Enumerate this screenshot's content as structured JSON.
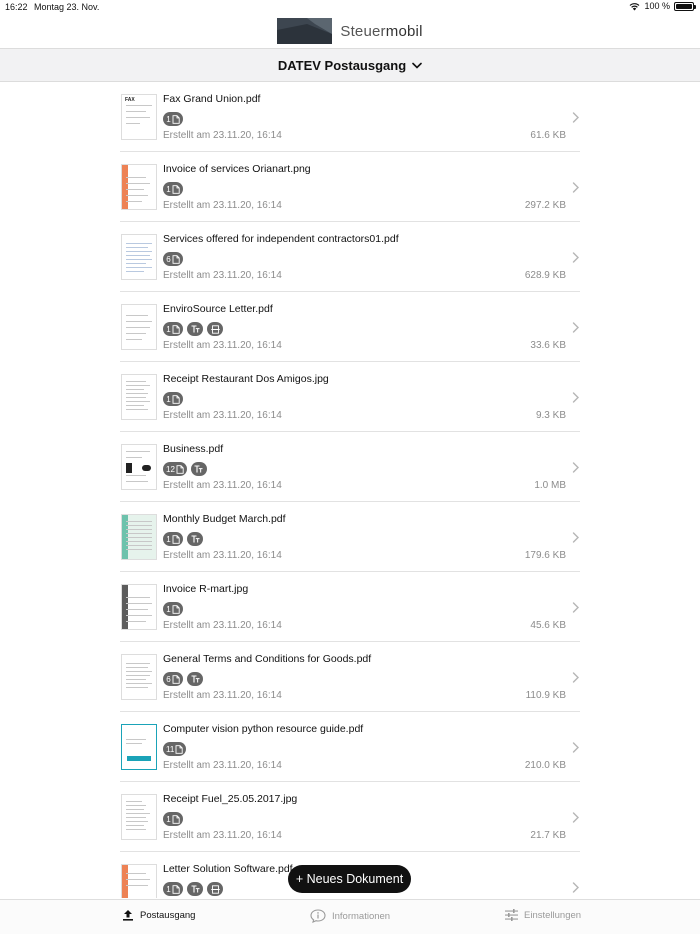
{
  "status": {
    "time": "16:22",
    "date": "Montag 23. Nov.",
    "battery": "100 %"
  },
  "brand": {
    "name_light": "Steuer",
    "name_bold": "mobil"
  },
  "header": {
    "title": "DATEV Postausgang"
  },
  "documents": [
    {
      "name": "Fax Grand Union.pdf",
      "pages": "1",
      "extra": [],
      "created": "Erstellt am 23.11.20, 16:14",
      "size": "61.6 KB"
    },
    {
      "name": "Invoice of services Orianart.png",
      "pages": "1",
      "extra": [],
      "created": "Erstellt am 23.11.20, 16:14",
      "size": "297.2 KB"
    },
    {
      "name": "Services offered for independent contractors01.pdf",
      "pages": "6",
      "extra": [],
      "created": "Erstellt am 23.11.20, 16:14",
      "size": "628.9 KB"
    },
    {
      "name": "EnviroSource Letter.pdf",
      "pages": "1",
      "extra": [
        "text",
        "scan"
      ],
      "created": "Erstellt am 23.11.20, 16:14",
      "size": "33.6 KB"
    },
    {
      "name": "Receipt Restaurant Dos Amigos.jpg",
      "pages": "1",
      "extra": [],
      "created": "Erstellt am 23.11.20, 16:14",
      "size": "9.3 KB"
    },
    {
      "name": "Business.pdf",
      "pages": "12",
      "extra": [
        "text"
      ],
      "created": "Erstellt am 23.11.20, 16:14",
      "size": "1.0 MB"
    },
    {
      "name": "Monthly Budget March.pdf",
      "pages": "1",
      "extra": [
        "text"
      ],
      "created": "Erstellt am 23.11.20, 16:14",
      "size": "179.6 KB"
    },
    {
      "name": "Invoice R-mart.jpg",
      "pages": "1",
      "extra": [],
      "created": "Erstellt am 23.11.20, 16:14",
      "size": "45.6 KB"
    },
    {
      "name": "General Terms and Conditions for Goods.pdf",
      "pages": "6",
      "extra": [
        "text"
      ],
      "created": "Erstellt am 23.11.20, 16:14",
      "size": "110.9 KB"
    },
    {
      "name": "Computer vision python resource guide.pdf",
      "pages": "11",
      "extra": [],
      "created": "Erstellt am 23.11.20, 16:14",
      "size": "210.0 KB"
    },
    {
      "name": "Receipt Fuel_25.05.2017.jpg",
      "pages": "1",
      "extra": [],
      "created": "Erstellt am 23.11.20, 16:14",
      "size": "21.7 KB"
    },
    {
      "name": "Letter Solution Software.pdf",
      "pages": "1",
      "extra": [
        "text",
        "scan"
      ],
      "created": "",
      "size": ""
    }
  ],
  "fab": {
    "label": "+ Neues Dokument"
  },
  "tabs": {
    "postausgang": "Postausgang",
    "informationen": "Informationen",
    "einstellungen": "Einstellungen"
  },
  "colors": {
    "badge": "#666666",
    "header_bg": "#f2f2f3",
    "fab_bg": "#111111",
    "accent_orange": "#e8632b",
    "accent_teal": "#1aa3b8"
  }
}
